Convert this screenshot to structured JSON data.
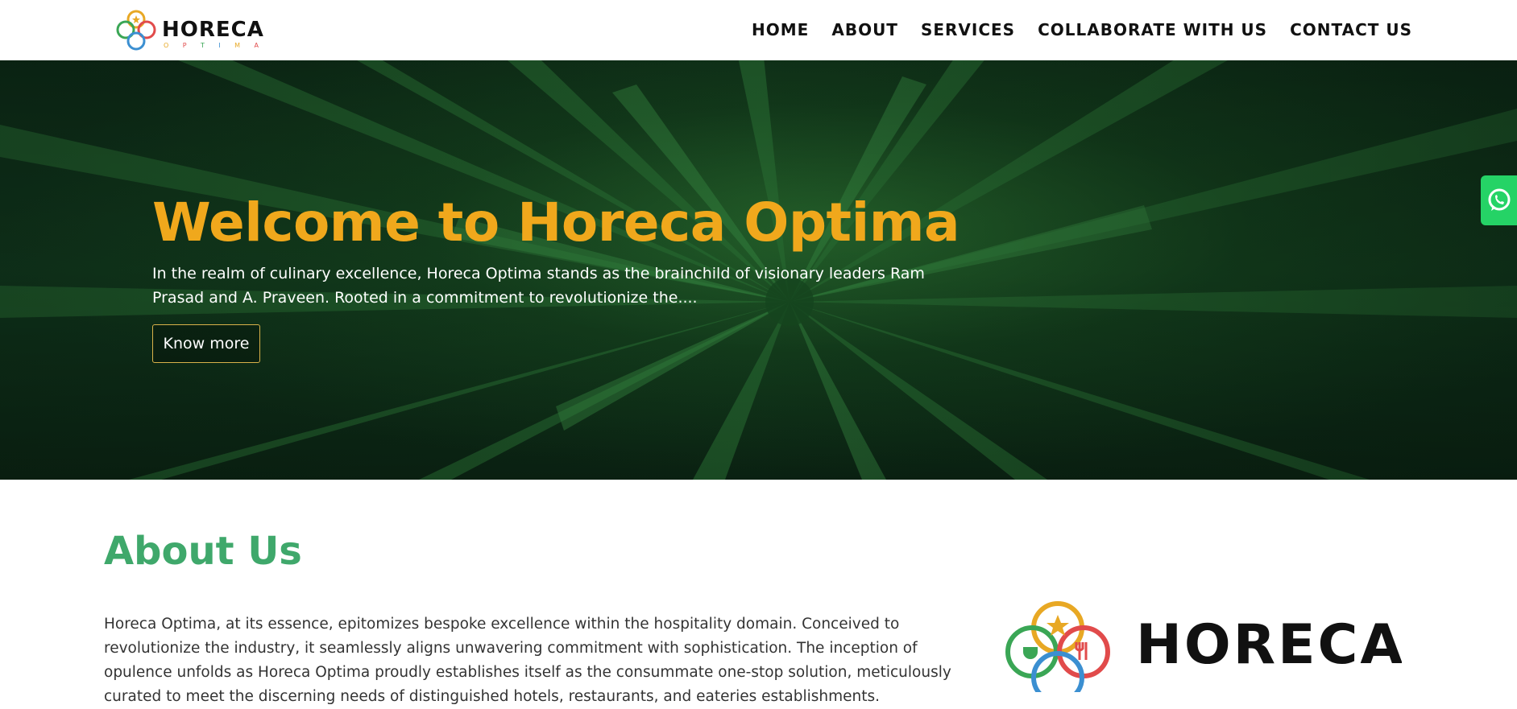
{
  "brand": {
    "name": "HORECA",
    "tagline_letters": [
      "O",
      "P",
      "T",
      "I",
      "M",
      "A"
    ]
  },
  "nav": {
    "items": [
      {
        "label": "HOME"
      },
      {
        "label": "ABOUT"
      },
      {
        "label": "SERVICES"
      },
      {
        "label": "COLLABORATE WITH US"
      },
      {
        "label": "CONTACT US"
      }
    ]
  },
  "hero": {
    "title": "Welcome to Horeca Optima",
    "text": "In the realm of culinary excellence, Horeca Optima stands as the brainchild of visionary leaders Ram Prasad and A. Praveen. Rooted in a commitment to revolutionize the....",
    "button_label": "Know more"
  },
  "whatsapp": {
    "icon": "whatsapp-icon"
  },
  "about": {
    "title": "About Us",
    "text": "Horeca Optima, at its essence, epitomizes bespoke excellence within the hospitality domain. Conceived to revolutionize the industry, it seamlessly aligns unwavering commitment with sophistication. The inception of opulence unfolds as Horeca Optima proudly establishes itself as the consummate one-stop solution, meticulously curated to meet the discerning needs of distinguished hotels, restaurants, and eateries establishments.",
    "logo_word": "HORECA"
  },
  "colors": {
    "accent_gold": "#f0a81c",
    "about_green": "#3fa86b",
    "whatsapp_green": "#25d366",
    "logo_orange": "#e8a824",
    "logo_red": "#e14b4b",
    "logo_green": "#3aa655",
    "logo_blue": "#3b8fd1"
  }
}
